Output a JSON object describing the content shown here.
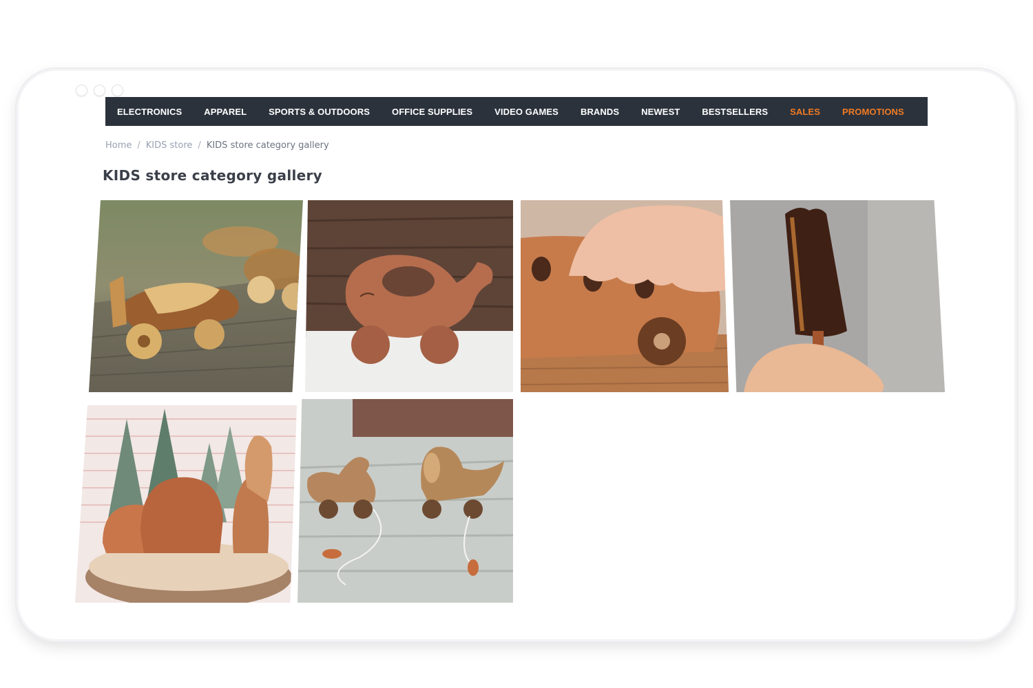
{
  "nav": {
    "items": [
      {
        "label": "ELECTRONICS",
        "accent": false
      },
      {
        "label": "APPAREL",
        "accent": false
      },
      {
        "label": "SPORTS & OUTDOORS",
        "accent": false
      },
      {
        "label": "OFFICE SUPPLIES",
        "accent": false
      },
      {
        "label": "VIDEO GAMES",
        "accent": false
      },
      {
        "label": "BRANDS",
        "accent": false
      },
      {
        "label": "NEWEST",
        "accent": false
      },
      {
        "label": "BESTSELLERS",
        "accent": false
      },
      {
        "label": "SALES",
        "accent": true
      },
      {
        "label": "PROMOTIONS",
        "accent": true
      }
    ],
    "background": "#2b323c",
    "accent_color": "#f07a24"
  },
  "breadcrumb": {
    "items": [
      "Home",
      "KIDS store"
    ],
    "current": "KIDS store category gallery",
    "separator": "/"
  },
  "page": {
    "title": "KIDS store category gallery"
  },
  "gallery": {
    "images": [
      {
        "subject": "wooden airplane toys"
      },
      {
        "subject": "wooden whale on wheels"
      },
      {
        "subject": "wooden bus toy held by child hand"
      },
      {
        "subject": "wooden ice cream popsicle toy"
      },
      {
        "subject": "wooden bears and trees set"
      },
      {
        "subject": "wooden duck and dog pull toys"
      }
    ]
  }
}
